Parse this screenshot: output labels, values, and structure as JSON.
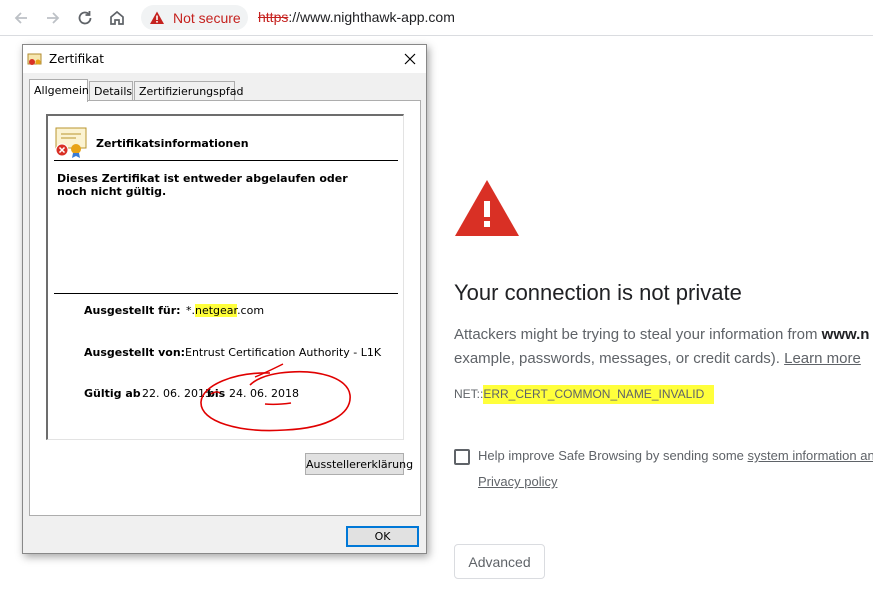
{
  "browser": {
    "back_icon": "arrow-left-icon",
    "forward_icon": "arrow-right-icon",
    "reload_icon": "reload-icon",
    "home_icon": "home-icon",
    "security_label": "Not secure",
    "url_scheme": "https",
    "url_rest": "://www.nighthawk-app.com"
  },
  "interstitial": {
    "headline": "Your connection is not private",
    "desc_line1_prefix": "Attackers might be trying to steal your information from ",
    "desc_line1_bold": "www.n",
    "desc_line2": "example, passwords, messages, or credit cards). ",
    "learn_more": "Learn more",
    "error_prefix": "NET::",
    "error_code": "ERR_CERT_COMMON_NAME_INVALID",
    "safe_browsing_text": "Help improve Safe Browsing by sending some ",
    "safe_browsing_link": "system information an",
    "privacy_policy": "Privacy policy",
    "advanced_label": "Advanced",
    "accent_red": "#d93025"
  },
  "cert_dialog": {
    "title": "Zertifikat",
    "tabs": [
      {
        "label": "Allgemein",
        "active": true
      },
      {
        "label": "Details",
        "active": false
      },
      {
        "label": "Zertifizierungspfad",
        "active": false
      }
    ],
    "info_title": "Zertifikatsinformationen",
    "warning": "Dieses Zertifikat ist entweder abgelaufen oder noch nicht gültig.",
    "issued_to_label": "Ausgestellt für:",
    "issued_to_prefix": "*.",
    "issued_to_highlight": "netgear",
    "issued_to_suffix": ".com",
    "issued_by_label": "Ausgestellt von:",
    "issued_by_value": "Entrust Certification Authority - L1K",
    "valid_from_label": "Gültig ab",
    "valid_from": "22. 06. 2015",
    "valid_to_label": "bis",
    "valid_to": "24. 06. 2018",
    "issuer_statement_button": "Ausstellererklärung",
    "ok_button": "OK",
    "highlight_color": "#ffff3b",
    "annotation_color": "#e00000"
  }
}
